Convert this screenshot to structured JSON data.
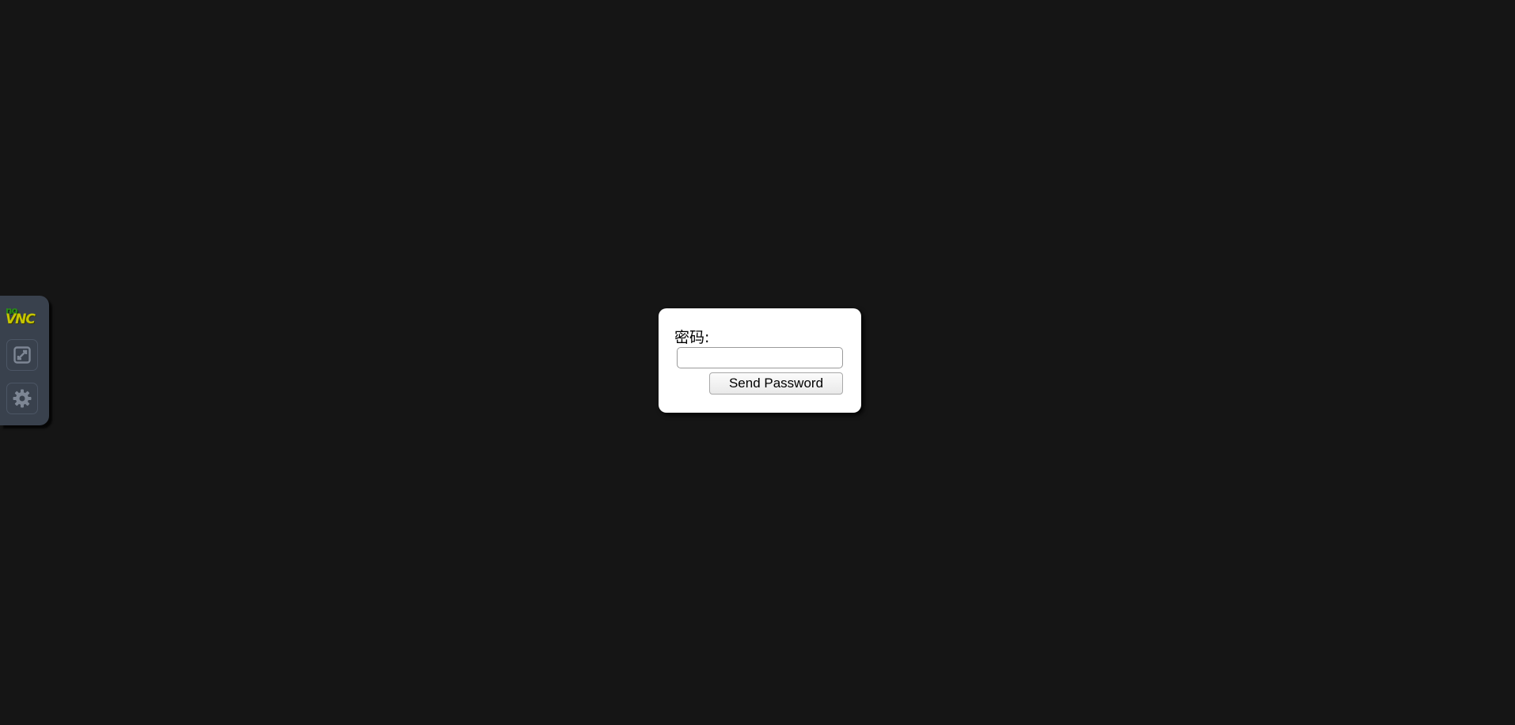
{
  "control_bar": {
    "logo": {
      "prefix": "no",
      "name": "VNC"
    },
    "buttons": [
      {
        "icon": "fullscreen-icon"
      },
      {
        "icon": "gear-icon"
      }
    ],
    "colors": {
      "background": "#39414d",
      "logo_prefix": "#2a8a1a",
      "logo_name": "#c6c600",
      "icon": "#7d8694"
    }
  },
  "dialog": {
    "label": "密码:",
    "password_value": "",
    "submit_label": "Send Password"
  }
}
